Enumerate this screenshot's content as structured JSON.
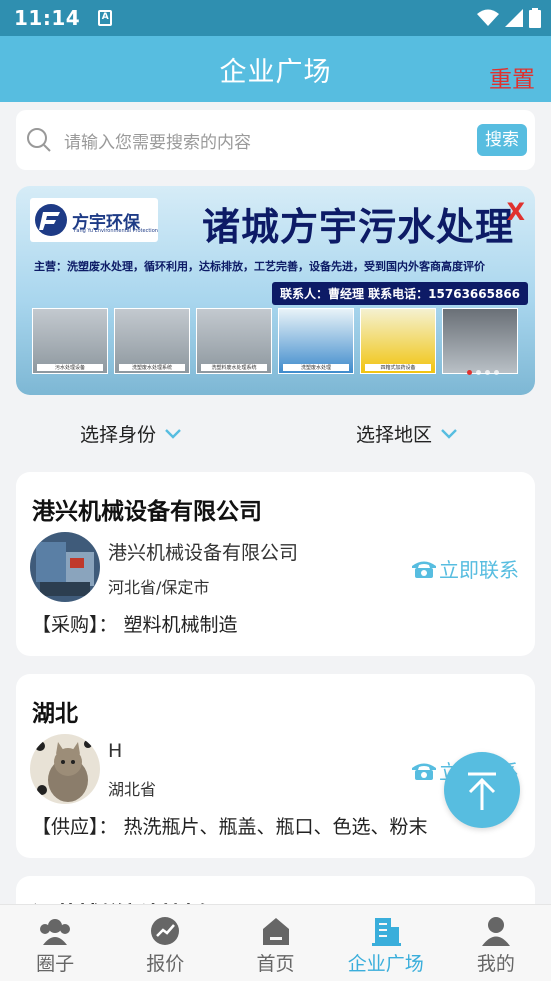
{
  "status_bar": {
    "time": "11:14",
    "app_badge": "A"
  },
  "header": {
    "title": "企业广场",
    "reset_label": "重置"
  },
  "search": {
    "placeholder": "请输入您需要搜索的内容",
    "button_label": "搜索"
  },
  "banner": {
    "logo_text": "方宇环保",
    "logo_sub": "Fang Yu Environmental Protection",
    "title": "诸城方宇污水处理",
    "close": "X",
    "line1": "主营：洗塑废水处理，循环利用，达标排放，工艺完善，设备先进，受到国内外客商高度评价",
    "contact": "联系人：曹经理   联系电话：15763665866",
    "photo_captions": [
      "污水处理设备",
      "洗塑废水处理系统",
      "洗塑料废水处理系统",
      "洗塑废水处理",
      "四箱式加药设备"
    ]
  },
  "filters": {
    "identity": "选择身份",
    "region": "选择地区"
  },
  "cards": [
    {
      "title": "港兴机械设备有限公司",
      "name": "港兴机械设备有限公司",
      "region": "河北省/保定市",
      "contact": "立即联系",
      "desc": "【采购】： 塑料机械制造"
    },
    {
      "title": "湖北",
      "name": "H",
      "region": "湖北省",
      "contact": "立即联系",
      "desc": "【供应】： 热洗瓶片、瓶盖、瓶口、色选、粉末"
    },
    {
      "title": "江苏博锐新材料有限公司"
    }
  ],
  "tabs": [
    {
      "label": "圈子",
      "icon": "people-icon"
    },
    {
      "label": "报价",
      "icon": "trend-icon"
    },
    {
      "label": "首页",
      "icon": "home-icon"
    },
    {
      "label": "企业广场",
      "icon": "building-icon",
      "active": true
    },
    {
      "label": "我的",
      "icon": "user-icon"
    }
  ],
  "colors": {
    "accent": "#57bde0",
    "status_bar": "#2f8fb0",
    "reset": "#e0322f"
  }
}
